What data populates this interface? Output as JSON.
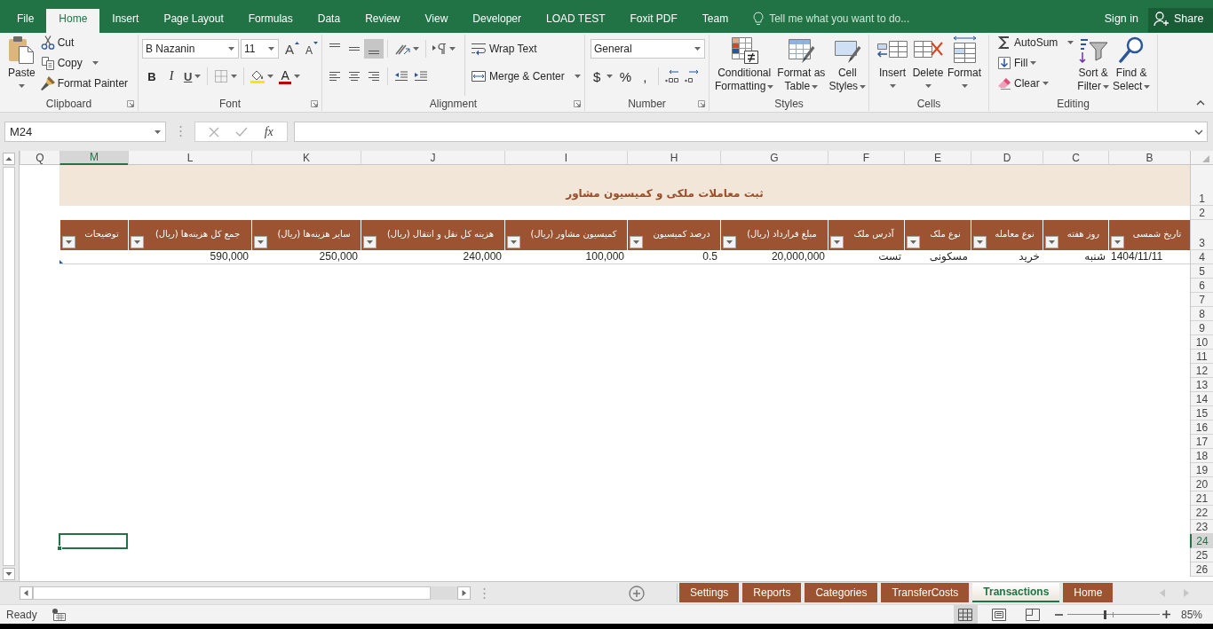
{
  "title_bar": {
    "tabs": [
      {
        "label": "File",
        "selected": false
      },
      {
        "label": "Home",
        "selected": true
      },
      {
        "label": "Insert",
        "selected": false
      },
      {
        "label": "Page Layout",
        "selected": false
      },
      {
        "label": "Formulas",
        "selected": false
      },
      {
        "label": "Data",
        "selected": false
      },
      {
        "label": "Review",
        "selected": false
      },
      {
        "label": "View",
        "selected": false
      },
      {
        "label": "Developer",
        "selected": false
      },
      {
        "label": "LOAD TEST",
        "selected": false
      },
      {
        "label": "Foxit PDF",
        "selected": false
      },
      {
        "label": "Team",
        "selected": false
      }
    ],
    "tell_me": {
      "placeholder": "Tell me what you want to do..."
    },
    "sign_in": "Sign in",
    "share": "Share"
  },
  "ribbon": {
    "clipboard": {
      "label": "Clipboard",
      "paste": "Paste",
      "cut": "Cut",
      "copy": "Copy",
      "format_painter": "Format Painter"
    },
    "font": {
      "label": "Font",
      "font_name": "B Nazanin",
      "font_size": "11",
      "grow_font": "A",
      "shrink_font": "A",
      "bold": "B",
      "italic": "I",
      "underline": "U",
      "font_color": "A"
    },
    "alignment": {
      "label": "Alignment",
      "vertical": [
        {
          "kind": "top",
          "selected": false
        },
        {
          "kind": "middle",
          "selected": false
        },
        {
          "kind": "bottom",
          "selected": true
        }
      ],
      "horizontal": [
        {
          "kind": "left",
          "selected": false
        },
        {
          "kind": "center",
          "selected": false
        },
        {
          "kind": "right",
          "selected": false
        }
      ],
      "wrap_text": "Wrap Text",
      "merge_center": "Merge & Center"
    },
    "number": {
      "label": "Number",
      "format": "General",
      "currency": "$",
      "percent": "%",
      "comma": ","
    },
    "styles": {
      "label": "Styles",
      "buttons": [
        {
          "kind": "conditional_formatting",
          "label": "Conditional\nFormatting"
        },
        {
          "kind": "format_as_table",
          "label": "Format as\nTable"
        },
        {
          "kind": "cell_styles",
          "label": "Cell\nStyles"
        }
      ]
    },
    "cells": {
      "label": "Cells",
      "buttons": [
        {
          "kind": "insert",
          "label": "Insert"
        },
        {
          "kind": "delete",
          "label": "Delete"
        },
        {
          "kind": "format",
          "label": "Format"
        }
      ]
    },
    "editing": {
      "label": "Editing",
      "commands": [
        {
          "kind": "autosum",
          "label": "AutoSum"
        },
        {
          "kind": "fill",
          "label": "Fill"
        },
        {
          "kind": "clear",
          "label": "Clear"
        }
      ],
      "buttons": [
        {
          "kind": "sort_filter",
          "label": "Sort &\nFilter"
        },
        {
          "kind": "find_select",
          "label": "Find &\nSelect"
        }
      ]
    }
  },
  "formula_bar": {
    "name_box": "M24",
    "insert_function": "fx"
  },
  "sheet": {
    "columns": [
      {
        "label": "Q",
        "selected": false
      },
      {
        "label": "M",
        "selected": true
      },
      {
        "label": "L",
        "selected": false
      },
      {
        "label": "K",
        "selected": false
      },
      {
        "label": "J",
        "selected": false
      },
      {
        "label": "I",
        "selected": false
      },
      {
        "label": "H",
        "selected": false
      },
      {
        "label": "G",
        "selected": false
      },
      {
        "label": "F",
        "selected": false
      },
      {
        "label": "E",
        "selected": false
      },
      {
        "label": "D",
        "selected": false
      },
      {
        "label": "C",
        "selected": false
      },
      {
        "label": "B",
        "selected": false
      }
    ],
    "rows": [
      {
        "label": "1",
        "selected": false
      },
      {
        "label": "2",
        "selected": false
      },
      {
        "label": "3",
        "selected": false
      },
      {
        "label": "4",
        "selected": false
      },
      {
        "label": "5",
        "selected": false
      },
      {
        "label": "6",
        "selected": false
      },
      {
        "label": "7",
        "selected": false
      },
      {
        "label": "8",
        "selected": false
      },
      {
        "label": "9",
        "selected": false
      },
      {
        "label": "10",
        "selected": false
      },
      {
        "label": "11",
        "selected": false
      },
      {
        "label": "12",
        "selected": false
      },
      {
        "label": "13",
        "selected": false
      },
      {
        "label": "14",
        "selected": false
      },
      {
        "label": "15",
        "selected": false
      },
      {
        "label": "16",
        "selected": false
      },
      {
        "label": "17",
        "selected": false
      },
      {
        "label": "18",
        "selected": false
      },
      {
        "label": "19",
        "selected": false
      },
      {
        "label": "20",
        "selected": false
      },
      {
        "label": "21",
        "selected": false
      },
      {
        "label": "22",
        "selected": false
      },
      {
        "label": "23",
        "selected": false
      },
      {
        "label": "24",
        "selected": true
      },
      {
        "label": "25",
        "selected": false
      },
      {
        "label": "26",
        "selected": false
      }
    ],
    "title": "ثبت معاملات ملکی و کمیسیون مشاور",
    "table": {
      "columns": [
        "توضیحات",
        "جمع کل هزینه‌ها (ریال)",
        "سایر هزینه‌ها (ریال)",
        "هزینه کل نقل و انتقال (ریال)",
        "کمیسیون مشاور (ریال)",
        "درصد کمیسیون",
        "مبلغ قرارداد (ریال)",
        "آدرس ملک",
        "نوع ملک",
        "نوع معامله",
        "روز هفته",
        "تاریخ شمسی"
      ],
      "rows": [
        {
          "cells": [
            null,
            "590,000",
            "250,000",
            "240,000",
            "100,000",
            "0.5",
            "20,000,000",
            "تست",
            "مسکونی",
            "خرید",
            "شنبه",
            "1404/11/11"
          ]
        }
      ]
    }
  },
  "sheet_tabs": [
    {
      "label": "Settings",
      "selected": false
    },
    {
      "label": "Reports",
      "selected": false
    },
    {
      "label": "Categories",
      "selected": false
    },
    {
      "label": "TransferCosts",
      "selected": false
    },
    {
      "label": "Transactions",
      "selected": true
    },
    {
      "label": "Home",
      "selected": false
    }
  ],
  "status_bar": {
    "status": "Ready",
    "views": [
      {
        "kind": "normal",
        "selected": true
      },
      {
        "kind": "page_layout",
        "selected": false
      },
      {
        "kind": "page_break_preview",
        "selected": false
      }
    ],
    "zoom": {
      "level": 0.4,
      "reading": "85%"
    }
  }
}
